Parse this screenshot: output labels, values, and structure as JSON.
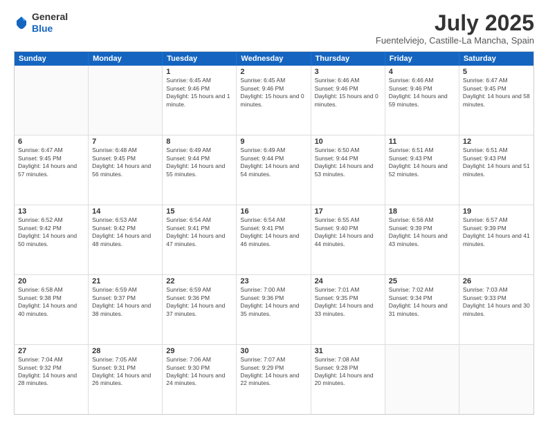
{
  "header": {
    "logo_line1": "General",
    "logo_line2": "Blue",
    "month_title": "July 2025",
    "location": "Fuentelviejo, Castille-La Mancha, Spain"
  },
  "weekdays": [
    "Sunday",
    "Monday",
    "Tuesday",
    "Wednesday",
    "Thursday",
    "Friday",
    "Saturday"
  ],
  "rows": [
    [
      {
        "day": "",
        "empty": true
      },
      {
        "day": "",
        "empty": true
      },
      {
        "day": "1",
        "sunrise": "6:45 AM",
        "sunset": "9:46 PM",
        "daylight": "15 hours and 1 minute."
      },
      {
        "day": "2",
        "sunrise": "6:45 AM",
        "sunset": "9:46 PM",
        "daylight": "15 hours and 0 minutes."
      },
      {
        "day": "3",
        "sunrise": "6:46 AM",
        "sunset": "9:46 PM",
        "daylight": "15 hours and 0 minutes."
      },
      {
        "day": "4",
        "sunrise": "6:46 AM",
        "sunset": "9:46 PM",
        "daylight": "14 hours and 59 minutes."
      },
      {
        "day": "5",
        "sunrise": "6:47 AM",
        "sunset": "9:45 PM",
        "daylight": "14 hours and 58 minutes."
      }
    ],
    [
      {
        "day": "6",
        "sunrise": "6:47 AM",
        "sunset": "9:45 PM",
        "daylight": "14 hours and 57 minutes."
      },
      {
        "day": "7",
        "sunrise": "6:48 AM",
        "sunset": "9:45 PM",
        "daylight": "14 hours and 56 minutes."
      },
      {
        "day": "8",
        "sunrise": "6:49 AM",
        "sunset": "9:44 PM",
        "daylight": "14 hours and 55 minutes."
      },
      {
        "day": "9",
        "sunrise": "6:49 AM",
        "sunset": "9:44 PM",
        "daylight": "14 hours and 54 minutes."
      },
      {
        "day": "10",
        "sunrise": "6:50 AM",
        "sunset": "9:44 PM",
        "daylight": "14 hours and 53 minutes."
      },
      {
        "day": "11",
        "sunrise": "6:51 AM",
        "sunset": "9:43 PM",
        "daylight": "14 hours and 52 minutes."
      },
      {
        "day": "12",
        "sunrise": "6:51 AM",
        "sunset": "9:43 PM",
        "daylight": "14 hours and 51 minutes."
      }
    ],
    [
      {
        "day": "13",
        "sunrise": "6:52 AM",
        "sunset": "9:42 PM",
        "daylight": "14 hours and 50 minutes."
      },
      {
        "day": "14",
        "sunrise": "6:53 AM",
        "sunset": "9:42 PM",
        "daylight": "14 hours and 48 minutes."
      },
      {
        "day": "15",
        "sunrise": "6:54 AM",
        "sunset": "9:41 PM",
        "daylight": "14 hours and 47 minutes."
      },
      {
        "day": "16",
        "sunrise": "6:54 AM",
        "sunset": "9:41 PM",
        "daylight": "14 hours and 46 minutes."
      },
      {
        "day": "17",
        "sunrise": "6:55 AM",
        "sunset": "9:40 PM",
        "daylight": "14 hours and 44 minutes."
      },
      {
        "day": "18",
        "sunrise": "6:56 AM",
        "sunset": "9:39 PM",
        "daylight": "14 hours and 43 minutes."
      },
      {
        "day": "19",
        "sunrise": "6:57 AM",
        "sunset": "9:39 PM",
        "daylight": "14 hours and 41 minutes."
      }
    ],
    [
      {
        "day": "20",
        "sunrise": "6:58 AM",
        "sunset": "9:38 PM",
        "daylight": "14 hours and 40 minutes."
      },
      {
        "day": "21",
        "sunrise": "6:59 AM",
        "sunset": "9:37 PM",
        "daylight": "14 hours and 38 minutes."
      },
      {
        "day": "22",
        "sunrise": "6:59 AM",
        "sunset": "9:36 PM",
        "daylight": "14 hours and 37 minutes."
      },
      {
        "day": "23",
        "sunrise": "7:00 AM",
        "sunset": "9:36 PM",
        "daylight": "14 hours and 35 minutes."
      },
      {
        "day": "24",
        "sunrise": "7:01 AM",
        "sunset": "9:35 PM",
        "daylight": "14 hours and 33 minutes."
      },
      {
        "day": "25",
        "sunrise": "7:02 AM",
        "sunset": "9:34 PM",
        "daylight": "14 hours and 31 minutes."
      },
      {
        "day": "26",
        "sunrise": "7:03 AM",
        "sunset": "9:33 PM",
        "daylight": "14 hours and 30 minutes."
      }
    ],
    [
      {
        "day": "27",
        "sunrise": "7:04 AM",
        "sunset": "9:32 PM",
        "daylight": "14 hours and 28 minutes."
      },
      {
        "day": "28",
        "sunrise": "7:05 AM",
        "sunset": "9:31 PM",
        "daylight": "14 hours and 26 minutes."
      },
      {
        "day": "29",
        "sunrise": "7:06 AM",
        "sunset": "9:30 PM",
        "daylight": "14 hours and 24 minutes."
      },
      {
        "day": "30",
        "sunrise": "7:07 AM",
        "sunset": "9:29 PM",
        "daylight": "14 hours and 22 minutes."
      },
      {
        "day": "31",
        "sunrise": "7:08 AM",
        "sunset": "9:28 PM",
        "daylight": "14 hours and 20 minutes."
      },
      {
        "day": "",
        "empty": true
      },
      {
        "day": "",
        "empty": true
      }
    ]
  ]
}
